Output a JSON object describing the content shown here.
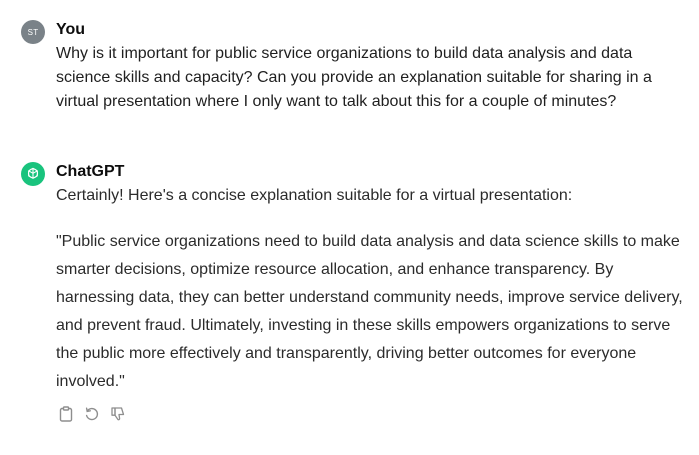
{
  "conversation": {
    "user": {
      "avatar_initials": "ST",
      "name": "You",
      "message": "Why is it important for public service organizations to build data analysis and data science skills and capacity? Can you provide an explanation suitable for sharing in a virtual presentation where I only want to talk about this for a couple of minutes?"
    },
    "assistant": {
      "name": "ChatGPT",
      "avatar_icon": "openai-logo-icon",
      "paragraphs": [
        "Certainly! Here's a concise explanation suitable for a virtual presentation:",
        "\"Public service organizations need to build data analysis and data science skills to make smarter decisions, optimize resource allocation, and enhance transparency. By harnessing data, they can better understand community needs, improve service delivery, and prevent fraud. Ultimately, investing in these skills empowers organizations to serve the public more effectively and transparently, driving better outcomes for everyone involved.\""
      ],
      "actions": [
        "copy-icon",
        "regenerate-icon",
        "thumbs-down-icon"
      ]
    }
  },
  "colors": {
    "user_avatar": "#7a8288",
    "assistant_avatar": "#19c37d",
    "icon_gray": "#8e8e8e"
  }
}
